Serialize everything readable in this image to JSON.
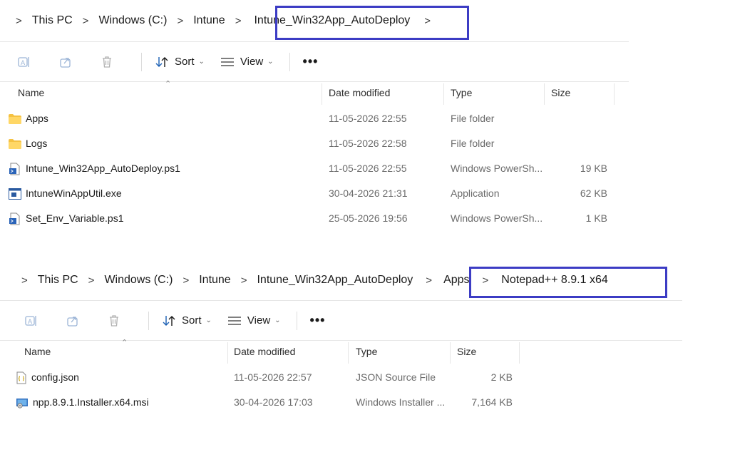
{
  "explorer1": {
    "breadcrumb": [
      "This PC",
      "Windows (C:)",
      "Intune",
      "Intune_Win32App_AutoDeploy"
    ],
    "toolbar": {
      "sort_label": "Sort",
      "view_label": "View",
      "more_label": "•••"
    },
    "columns": {
      "name": "Name",
      "date": "Date modified",
      "type": "Type",
      "size": "Size"
    },
    "files": [
      {
        "name": "Apps",
        "date": "11-05-2026 22:55",
        "type": "File folder",
        "size": "",
        "icon": "folder-icon"
      },
      {
        "name": "Logs",
        "date": "11-05-2026 22:58",
        "type": "File folder",
        "size": "",
        "icon": "folder-icon"
      },
      {
        "name": "Intune_Win32App_AutoDeploy.ps1",
        "date": "11-05-2026 22:55",
        "type": "Windows PowerSh...",
        "size": "19 KB",
        "icon": "powershell-script-icon"
      },
      {
        "name": "IntuneWinAppUtil.exe",
        "date": "30-04-2026 21:31",
        "type": "Application",
        "size": "62 KB",
        "icon": "application-icon"
      },
      {
        "name": "Set_Env_Variable.ps1",
        "date": "25-05-2026 19:56",
        "type": "Windows PowerSh...",
        "size": "1 KB",
        "icon": "powershell-script-icon"
      }
    ]
  },
  "explorer2": {
    "breadcrumb": [
      "This PC",
      "Windows (C:)",
      "Intune",
      "Intune_Win32App_AutoDeploy",
      "Apps",
      "Notepad++ 8.9.1 x64"
    ],
    "toolbar": {
      "sort_label": "Sort",
      "view_label": "View",
      "more_label": "•••"
    },
    "columns": {
      "name": "Name",
      "date": "Date modified",
      "type": "Type",
      "size": "Size"
    },
    "files": [
      {
        "name": "config.json",
        "date": "11-05-2026 22:57",
        "type": "JSON Source File",
        "size": "2 KB",
        "icon": "json-file-icon"
      },
      {
        "name": "npp.8.9.1.Installer.x64.msi",
        "date": "30-04-2026 17:03",
        "type": "Windows Installer ...",
        "size": "7,164 KB",
        "icon": "msi-installer-icon"
      }
    ]
  },
  "colors": {
    "highlight": "#3c3cc4",
    "folder": "#f5c242"
  }
}
